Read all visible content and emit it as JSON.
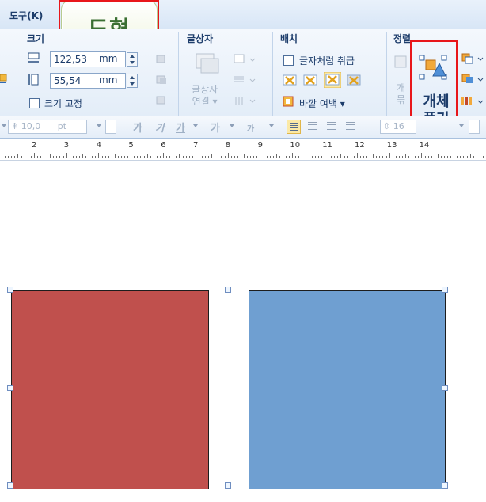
{
  "menubar": {
    "tools_menu": "도구(K)",
    "active_tab": "도형"
  },
  "ribbon": {
    "size": {
      "title": "크기",
      "width_value": "122,53",
      "height_value": "55,54",
      "unit": "mm",
      "fix_size_label": "크기 고정"
    },
    "textbox": {
      "title": "글상자",
      "link_label_line1": "글상자",
      "link_label_line2": "연결"
    },
    "arrange": {
      "title": "배치",
      "treat_as_char_label": "글자처럼 취급",
      "outer_margin_label": "바깥 여백"
    },
    "align": {
      "title": "정렬",
      "partial_label_1": "개",
      "partial_label_2": "묶",
      "ungroup_label_line1": "개체",
      "ungroup_label_line2": "풀기"
    }
  },
  "format_toolbar": {
    "font_size": "10,0",
    "font_unit": "pt",
    "bold_glyph": "가",
    "italic_glyph": "가",
    "underline_glyph": "가",
    "strike_glyph": "가",
    "small_glyph": "가",
    "line_spacing": "16"
  },
  "ruler": {
    "labels": [
      "2",
      "3",
      "4",
      "5",
      "6",
      "7",
      "8",
      "9",
      "10",
      "11",
      "12",
      "13",
      "14"
    ]
  },
  "canvas": {
    "shapes": [
      {
        "name": "red-square",
        "fill": "#c0504d",
        "selected": true
      },
      {
        "name": "blue-square",
        "fill": "#6f9fd1",
        "selected": true
      }
    ]
  }
}
